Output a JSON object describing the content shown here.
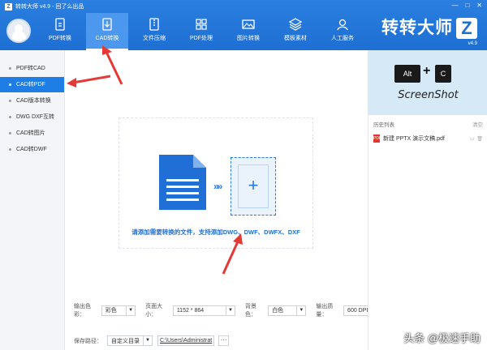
{
  "app": {
    "title": "转转大师 v4.9 - 回了么出品",
    "logo_letter": "Z"
  },
  "window": {
    "controls": [
      "—",
      "□",
      "✕"
    ]
  },
  "nav": [
    {
      "label": "PDF转换",
      "icon": "pdf-convert-icon"
    },
    {
      "label": "CAD转换",
      "icon": "cad-convert-icon",
      "active": true
    },
    {
      "label": "文件压缩",
      "icon": "zip-icon"
    },
    {
      "label": "PDF处理",
      "icon": "pdf-process-icon"
    },
    {
      "label": "图片转换",
      "icon": "image-icon"
    },
    {
      "label": "模板素材",
      "icon": "template-icon"
    },
    {
      "label": "人工服务",
      "icon": "support-icon"
    }
  ],
  "brand": {
    "name": "转转大师",
    "letter": "Z",
    "version": "v4.9"
  },
  "sidebar": {
    "items": [
      {
        "label": "PDF转CAD"
      },
      {
        "label": "CAD转PDF",
        "active": true
      },
      {
        "label": "CAD版本转换"
      },
      {
        "label": "DWG DXF互转"
      },
      {
        "label": "CAD转图片"
      },
      {
        "label": "CAD转DWF"
      }
    ]
  },
  "main": {
    "arrows_glyph": "»»",
    "plus_glyph": "+",
    "drop_hint": "请添加需要转换的文件，支持添加DWG、DWF、DWFX、DXF"
  },
  "settings": {
    "output_color_label": "输出色彩：",
    "output_color_value": "彩色",
    "page_size_label": "页面大小：",
    "page_size_value": "1152 * 864",
    "background_label": "背景色：",
    "background_value": "白色",
    "quality_label": "输出质量：",
    "quality_value": "600 DPI",
    "save_path_label": "保存路径：",
    "save_path_mode": "自定义目录",
    "save_path_value": "C:\\Users\\Administrat",
    "browse_label": "···"
  },
  "ad": {
    "key1": "Alt",
    "plus": "+",
    "key2": "C",
    "caption": "ScreenShot"
  },
  "history": {
    "title": "历史列表",
    "clear_label": "清空",
    "items": [
      {
        "name": "新建 PPTX 演示文稿.pdf",
        "type": "PDF"
      }
    ]
  },
  "watermark": "头条 @极速手助",
  "colors": {
    "accent": "#1e6fd3",
    "sidebar_active": "#1e7ee6",
    "annotation": "#e53935"
  }
}
